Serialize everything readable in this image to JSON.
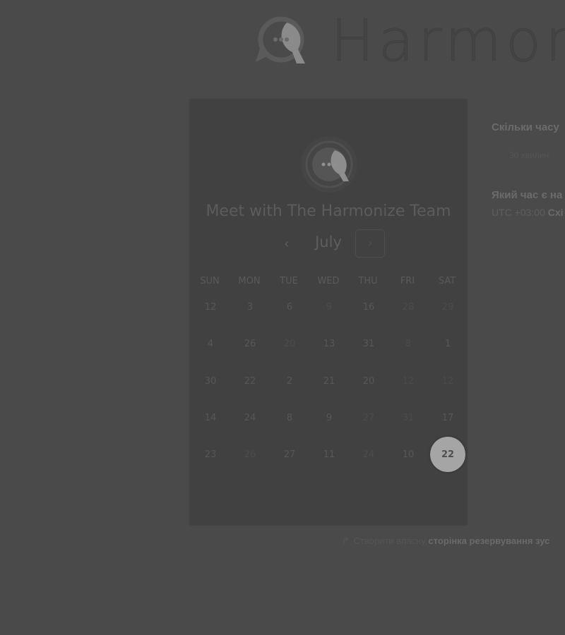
{
  "brand": {
    "name": "Harmonize"
  },
  "booking": {
    "title": "Meet with The Harmonize Team",
    "month": "July",
    "prev_icon": "chevron-left-icon",
    "next_icon": "chevron-right-icon",
    "weekdays": [
      "SUN",
      "MON",
      "TUE",
      "WED",
      "THU",
      "FRI",
      "SAT"
    ],
    "weeks": [
      [
        "12",
        "3",
        "6",
        "9",
        "16",
        "28",
        "29"
      ],
      [
        "4",
        "26",
        "20",
        "13",
        "31",
        "8",
        "1"
      ],
      [
        "30",
        "22",
        "2",
        "21",
        "20",
        "12",
        "12"
      ],
      [
        "14",
        "24",
        "8",
        "9",
        "27",
        "31",
        "17"
      ],
      [
        "23",
        "26",
        "27",
        "11",
        "24",
        "10",
        "22"
      ]
    ],
    "selected_day": "22"
  },
  "details": {
    "duration_question": "Скільки часу",
    "duration_value": "30 хвилин",
    "timezone_question": "Який час є на",
    "timezone_offset": "UTC +03:00",
    "timezone_name": "Схі"
  },
  "footer": {
    "icon": "link-icon",
    "text": "Створити власну",
    "link": "сторінка резервування зус"
  }
}
